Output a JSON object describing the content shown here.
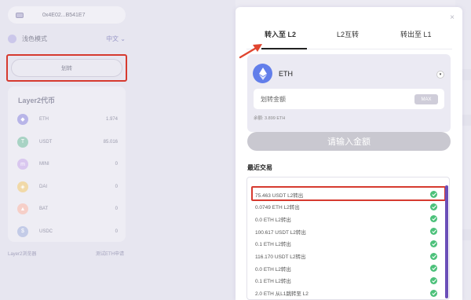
{
  "left": {
    "wallet_address": "0x4E02...B541E7",
    "mode_label": "浅色模式",
    "language": "中文 ⌄",
    "transfer_button": "划转",
    "tokens_title": "Layer2代币",
    "tokens": [
      {
        "symbol": "ETH",
        "value": "1.974",
        "color": "#b8b5e8",
        "glyph": "◆"
      },
      {
        "symbol": "USDT",
        "value": "85.016",
        "color": "#a8d3c4",
        "glyph": "T"
      },
      {
        "symbol": "MINI",
        "value": "0",
        "color": "#d9c7ef",
        "glyph": "m"
      },
      {
        "symbol": "DAI",
        "value": "0",
        "color": "#f1d9a8",
        "glyph": "◈"
      },
      {
        "symbol": "BAT",
        "value": "0",
        "color": "#f6cfc8",
        "glyph": "▲"
      },
      {
        "symbol": "USDC",
        "value": "0",
        "color": "#c3cbe7",
        "glyph": "$"
      }
    ],
    "footer_left": "Layer2浏览器",
    "footer_right": "测试ETH申请"
  },
  "modal": {
    "close_glyph": "×",
    "tabs": [
      {
        "label": "转入至 L2",
        "active": true
      },
      {
        "label": "L2互转",
        "active": false
      },
      {
        "label": "转出至 L1",
        "active": false
      }
    ],
    "token_name": "ETH",
    "amount_placeholder": "划转金额",
    "max_label": "MAX",
    "balance": "余额: 3.899 ETH",
    "submit_label": "请输入金额",
    "recent_title": "最近交易",
    "transactions": [
      "75.463 USDT L2转出",
      "0.0749 ETH L2转出",
      "0.0 ETH L2转出",
      "100.617 USDT L2转出",
      "0.1 ETH L2转出",
      "116.170 USDT L2转出",
      "0.0 ETH L2转出",
      "0.1 ETH L2转出",
      "2.0 ETH 从L1跳转至 L2"
    ]
  },
  "colors": {
    "accent": "#6b4fb8",
    "highlight": "#d63a2f",
    "success": "#4cc17a",
    "eth": "#627eea"
  }
}
